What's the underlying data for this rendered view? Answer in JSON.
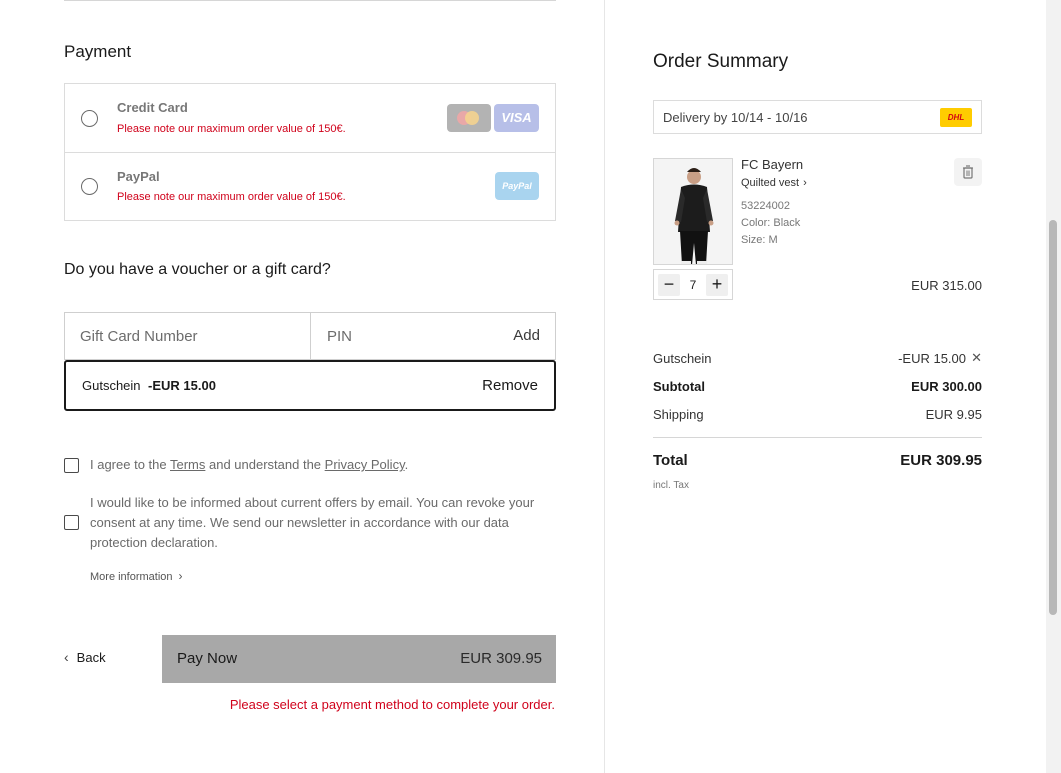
{
  "payment": {
    "heading": "Payment",
    "methods": [
      {
        "title": "Credit Card",
        "note": "Please note our maximum order value of 150€.",
        "icons": [
          "mastercard-icon",
          "visa-icon"
        ],
        "visa_label": "VISA"
      },
      {
        "title": "PayPal",
        "note": "Please note our maximum order value of 150€.",
        "icons": [
          "paypal-icon"
        ],
        "paypal_label": "PayPal"
      }
    ]
  },
  "voucher": {
    "heading": "Do you have a voucher or a gift card?",
    "gift_placeholder": "Gift Card Number",
    "pin_placeholder": "PIN",
    "add_label": "Add",
    "applied_code": "Gutschein",
    "applied_amount": "-EUR 15.00",
    "remove_label": "Remove"
  },
  "consents": {
    "agree_pre": "I agree to the ",
    "terms_link": "Terms",
    "agree_mid": " and understand the ",
    "privacy_link": "Privacy Policy",
    "agree_post": ".",
    "newsletter": "I would like to be informed about current offers by email. You can revoke your consent at any time. We send our newsletter in accordance with our data protection declaration.",
    "more_info": "More information"
  },
  "actions": {
    "back_label": "Back",
    "pay_now_label": "Pay Now",
    "pay_now_price": "EUR 309.95",
    "error": "Please select a payment method to complete your order."
  },
  "summary": {
    "heading": "Order Summary",
    "delivery": "Delivery by 10/14 - 10/16",
    "carrier_label": "DHL",
    "product": {
      "brand": "FC Bayern",
      "name": "Quilted vest",
      "sku": "53224002",
      "color": "Color: Black",
      "size": "Size: M",
      "quantity": "7",
      "price": "EUR 315.00"
    },
    "gutschein_label": "Gutschein",
    "gutschein_value": "-EUR 15.00",
    "subtotal_label": "Subtotal",
    "subtotal_value": "EUR 300.00",
    "shipping_label": "Shipping",
    "shipping_value": "EUR 9.95",
    "total_label": "Total",
    "total_value": "EUR 309.95",
    "tax_note": "incl. Tax"
  },
  "colors": {
    "error_red": "#d0021b",
    "pay_button_disabled": "#a8a8a8",
    "dhl_yellow": "#ffcc00"
  }
}
